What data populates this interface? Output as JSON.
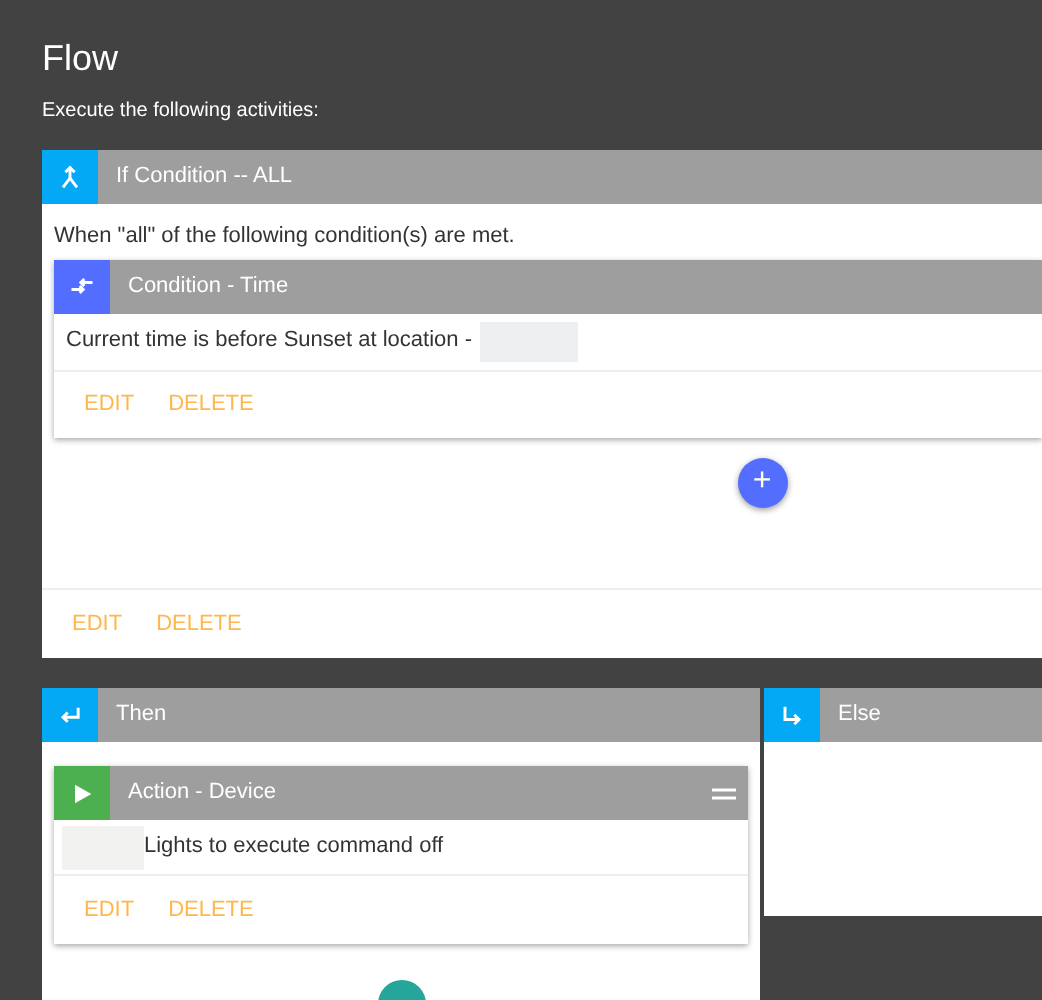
{
  "title": "Flow",
  "subtitle": "Execute the following activities:",
  "if_card": {
    "title": "If Condition -- ALL",
    "kind": "merge",
    "color": "#03a9f4",
    "description": "When \"all\" of the following condition(s) are met.",
    "condition": {
      "title": "Condition - Time",
      "kind": "swap",
      "color": "#536dfe",
      "text": "Current time is before Sunset at location -",
      "actions": [
        "EDIT",
        "DELETE"
      ]
    },
    "add_button": "+",
    "actions": [
      "EDIT",
      "DELETE"
    ]
  },
  "then_card": {
    "title": "Then",
    "kind": "enter",
    "color": "#03a9f4",
    "action": {
      "title": "Action - Device",
      "kind": "play",
      "color": "#4caf50",
      "text": "Lights to execute command off",
      "actions": [
        "EDIT",
        "DELETE"
      ]
    }
  },
  "else_card": {
    "title": "Else",
    "kind": "branch",
    "color": "#03a9f4"
  }
}
